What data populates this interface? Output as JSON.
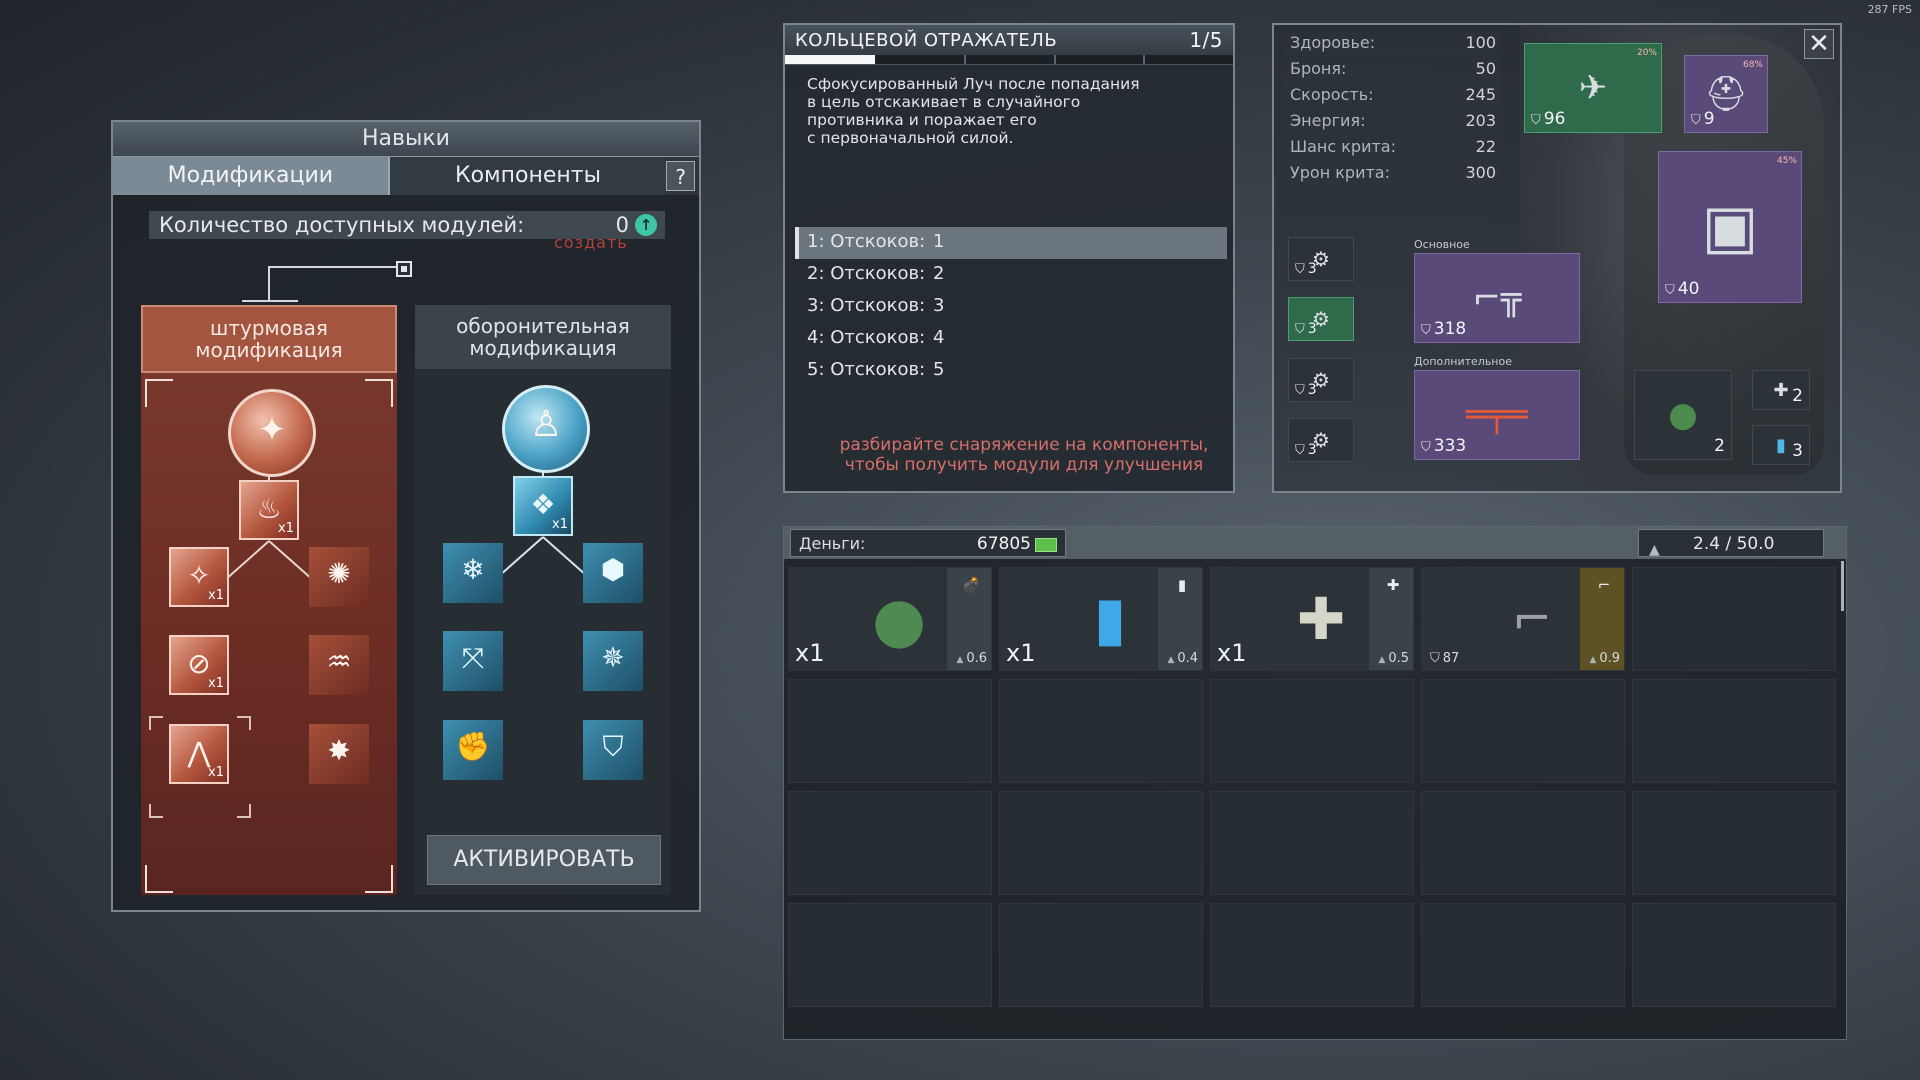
{
  "fps": "287 FPS",
  "skills": {
    "title": "Навыки",
    "tabs": [
      "Модификации",
      "Компоненты"
    ],
    "help": "?",
    "modules_label": "Количество  доступных  модулей:",
    "modules_count": "0",
    "create_label": "создать",
    "assault": {
      "title": "штурмовая\nмодификация"
    },
    "defense": {
      "title": "оборонительная\nмодификация"
    },
    "x1": "x1",
    "activate": "АКТИВИРОВАТЬ"
  },
  "description": {
    "title": "КОЛЬЦЕВОЙ ОТРАЖАТЕЛЬ",
    "level": "1/5",
    "text": "Сфокусированный Луч после попадания\nв цель отскакивает в случайного\nпротивника и поражает его\nс первоначальной силой.",
    "levels": [
      {
        "label": "1: Отскоков:",
        "value": "1"
      },
      {
        "label": "2: Отскоков:",
        "value": "2"
      },
      {
        "label": "3: Отскоков:",
        "value": "3"
      },
      {
        "label": "4: Отскоков:",
        "value": "4"
      },
      {
        "label": "5: Отскоков:",
        "value": "5"
      }
    ],
    "hint": "разбирайте снаряжение на компоненты,\nчтобы получить модули для улучшения"
  },
  "character": {
    "stats": [
      {
        "label": "Здоровье:",
        "value": "100"
      },
      {
        "label": "Броня:",
        "value": "50"
      },
      {
        "label": "Скорость:",
        "value": "245"
      },
      {
        "label": "Энергия:",
        "value": "203"
      },
      {
        "label": "Шанс  крита:",
        "value": "22"
      },
      {
        "label": "Урон  крита:",
        "value": "300"
      }
    ],
    "close": "✕",
    "drone": {
      "armor": "96",
      "pct": "20%"
    },
    "helmet": {
      "armor": "9",
      "pct": "68%"
    },
    "vest": {
      "armor": "40",
      "pct": "45%"
    },
    "small_slots": [
      "3",
      "3",
      "3",
      "3"
    ],
    "primary": {
      "label": "Основное",
      "armor": "318"
    },
    "secondary": {
      "label": "Дополнительное",
      "armor": "333"
    },
    "grenade": {
      "count": "2"
    },
    "bandage": {
      "count": "2"
    },
    "battery": {
      "count": "3"
    }
  },
  "inventory": {
    "money_label": "Деньги:",
    "money": "67805",
    "weight": "2.4 / 50.0",
    "items": [
      {
        "qty": "x1",
        "weight": "0.6",
        "type_icon": "💣"
      },
      {
        "qty": "x1",
        "weight": "0.4",
        "type_icon": "▮"
      },
      {
        "qty": "x1",
        "weight": "0.5",
        "type_icon": "✚"
      },
      {
        "armor": "87",
        "weight": "0.9",
        "type_icon": "⌐"
      }
    ]
  },
  "colors": {
    "assault": "#a4553f",
    "defense": "#2d86ad",
    "hint": "#d76f6a"
  }
}
